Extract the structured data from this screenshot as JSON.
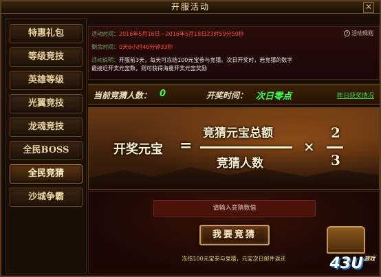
{
  "window": {
    "title": "开服活动",
    "close_glyph": "✕"
  },
  "sidebar": {
    "items": [
      {
        "label": "特惠礼包"
      },
      {
        "label": "等级竞技"
      },
      {
        "label": "英雄等级"
      },
      {
        "label": "光翼竞技"
      },
      {
        "label": "龙魂竞技"
      },
      {
        "label": "全民BOSS"
      },
      {
        "label": "全民竞猜"
      },
      {
        "label": "沙城争霸"
      }
    ],
    "active_index": 6
  },
  "info": {
    "time_label": "活动时间：",
    "time_value": "2016年5月16日－2016年5月18日23时59分59秒",
    "remain_label": "剩余时间：",
    "remain_value": "0天6小时40分钟33秒",
    "desc_label": "活动说明：",
    "desc_line1": "开服前3天，每天可冻结100元宝参与竞猜。次日开奖时，若竞猜的数字",
    "desc_line2": "最接近开奖元宝数，则可获得海量开奖元宝奖励",
    "rules_link": "活动规则",
    "rules_icon": "?"
  },
  "stats": {
    "count_label": "当前竞猜人数：",
    "count_value": "0",
    "draw_label": "开奖时间：",
    "draw_value": "次日零点",
    "history_link": "昨日获奖情况"
  },
  "formula": {
    "lhs": "开奖元宝",
    "equals": "=",
    "numerator": "竞猜元宝总额",
    "denominator": "竞猜人数",
    "times": "×",
    "frac_num": "2",
    "frac_den": "3"
  },
  "bet": {
    "placeholder": "请输入竞猜数值",
    "button_label": "我要竞猜",
    "note": "冻结100元宝参与竞猜，元宝次日邮件返还"
  },
  "logo": {
    "text": "43U",
    "suffix": ".com",
    "tag": "游戏"
  },
  "colors": {
    "accent_green": "#3cff4a",
    "accent_red": "#ff4b2e",
    "gold": "#c9a05a"
  }
}
